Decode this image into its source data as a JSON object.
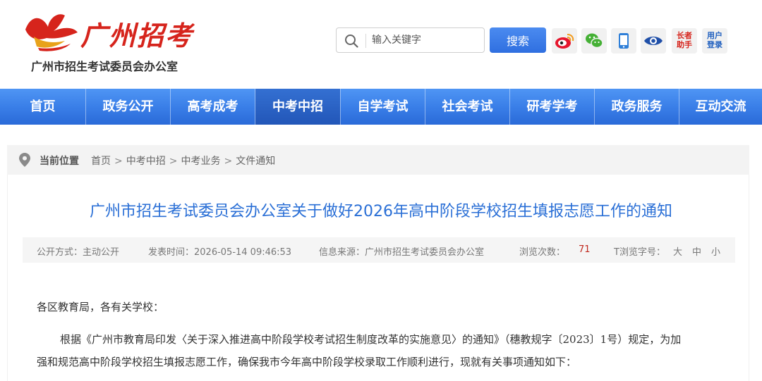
{
  "header": {
    "logo_title": "广州招考",
    "logo_subtitle": "广州市招生考试委员会办公室",
    "search_placeholder": "输入关键字",
    "search_button": "搜索",
    "tools": [
      {
        "icon": "weibo-icon"
      },
      {
        "icon": "wechat-icon"
      },
      {
        "icon": "mobile-icon"
      },
      {
        "icon": "eye-icon"
      },
      {
        "icon": "elder-assistant-icon",
        "label_line1": "长者",
        "label_line2": "助手"
      },
      {
        "icon": "user-login-icon",
        "label_line1": "用户",
        "label_line2": "登录"
      }
    ]
  },
  "nav": {
    "items": [
      {
        "label": "首页"
      },
      {
        "label": "政务公开"
      },
      {
        "label": "高考成考"
      },
      {
        "label": "中考中招"
      },
      {
        "label": "自学考试"
      },
      {
        "label": "社会考试"
      },
      {
        "label": "研考学考"
      },
      {
        "label": "政务服务"
      },
      {
        "label": "互动交流"
      }
    ],
    "active_index": 3
  },
  "breadcrumb": {
    "label": "当前位置",
    "items": [
      "首页",
      "中考中招",
      "中考业务",
      "文件通知"
    ],
    "separator": ">"
  },
  "article": {
    "title": "广州市招生考试委员会办公室关于做好2026年高中阶段学校招生填报志愿工作的通知",
    "meta": {
      "open_mode": "公开方式：主动公开",
      "publish_time": "发表时间：2026-05-14 09:46:53",
      "source": "信息来源：广州市招生考试委员会办公室",
      "views_label": "浏览次数：",
      "views_count": "71",
      "font_size_label": "T浏览字号：",
      "font_large": "大",
      "font_medium": "中",
      "font_small": "小"
    },
    "salutation": "各区教育局，各有关学校：",
    "paragraph1_line1": "根据《广州市教育局印发〈关于深入推进高中阶段学校考试招生制度改革的实施意见〉的通知》（穗教规字〔2023〕1号）规定，为加",
    "paragraph1_line2": "强和规范高中阶段学校招生填报志愿工作，确保我市今年高中阶段学校录取工作顺利进行，现就有关事项通知如下："
  },
  "colors": {
    "nav_blue": "#3a7fe8",
    "nav_active": "#2a5fc4",
    "title_blue": "#2a6fd6",
    "brand_red": "#d6241c",
    "view_count_red": "#c0291f"
  }
}
